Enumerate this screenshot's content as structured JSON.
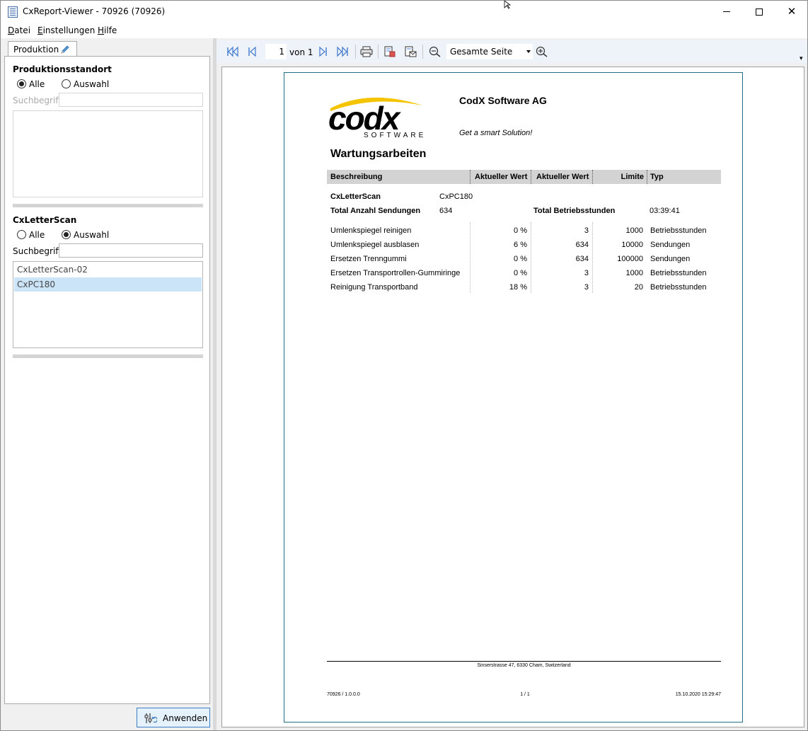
{
  "window": {
    "title": "CxReport-Viewer - 70926 (70926)"
  },
  "menu": [
    "Datei",
    "Einstellungen",
    "Hilfe"
  ],
  "left_panel": {
    "tab_label": "Produktion",
    "site_section": {
      "title": "Produktionsstandort",
      "options": [
        "Alle",
        "Auswahl"
      ],
      "selected": "Alle",
      "search_label": "Suchbegriff",
      "search_value": "",
      "items": []
    },
    "scanner_section": {
      "title": "CxLetterScan",
      "options": [
        "Alle",
        "Auswahl"
      ],
      "selected": "Auswahl",
      "search_label": "Suchbegriff",
      "search_value": "",
      "items": [
        "CxLetterScan-02",
        "CxPC180"
      ],
      "selected_item": "CxPC180"
    },
    "apply_button": "Anwenden"
  },
  "toolbar": {
    "page_number": "1",
    "page_of": "von 1",
    "zoom": "Gesamte Seite",
    "icons": [
      "first-page-icon",
      "prev-page-icon",
      "next-page-icon",
      "last-page-icon",
      "print-icon",
      "export-icon",
      "export-mail-icon",
      "zoom-out-icon",
      "zoom-in-icon"
    ]
  },
  "report": {
    "company": "CodX Software AG",
    "slogan": "Get a smart Solution!",
    "logo_text": {
      "main": "codx",
      "sub": "SOFTWARE"
    },
    "title": "Wartungsarbeiten",
    "columns": [
      "Beschreibung",
      "Aktueller Wert",
      "Aktueller Wert",
      "Limite",
      "Typ"
    ],
    "device_label": "CxLetterScan",
    "device_value": "CxPC180",
    "total_shipments_label": "Total Anzahl Sendungen",
    "total_shipments_value": "634",
    "total_hours_label": "Total Betriebsstunden",
    "total_hours_value": "03:39:41",
    "rows": [
      {
        "desc": "Umlenkspiegel reinigen",
        "pct": "0 %",
        "value": "3",
        "limit": "1000",
        "type": "Betriebsstunden"
      },
      {
        "desc": "Umlenkspiegel ausblasen",
        "pct": "6 %",
        "value": "634",
        "limit": "10000",
        "type": "Sendungen"
      },
      {
        "desc": "Ersetzen Trenngummi",
        "pct": "0 %",
        "value": "634",
        "limit": "100000",
        "type": "Sendungen"
      },
      {
        "desc": "Ersetzen Transportrollen-Gummiringe",
        "pct": "0 %",
        "value": "3",
        "limit": "1000",
        "type": "Betriebsstunden"
      },
      {
        "desc": "Reinigung Transportband",
        "pct": "18 %",
        "value": "3",
        "limit": "20",
        "type": "Betriebsstunden"
      }
    ],
    "footer": {
      "address": "Sinserstrasse 47, 6330 Cham, Switzerland",
      "report_id": "70926 / 1.0.0.0",
      "page": "1 / 1",
      "timestamp": "15.10.2020 15:29:47"
    }
  },
  "colors": {
    "accent": "#3b7cc4",
    "selection": "#cce4f7",
    "page_border": "#1f6f8b",
    "logo_yellow": "#f5c400",
    "toolbar_icons": "#4a7fd0"
  }
}
